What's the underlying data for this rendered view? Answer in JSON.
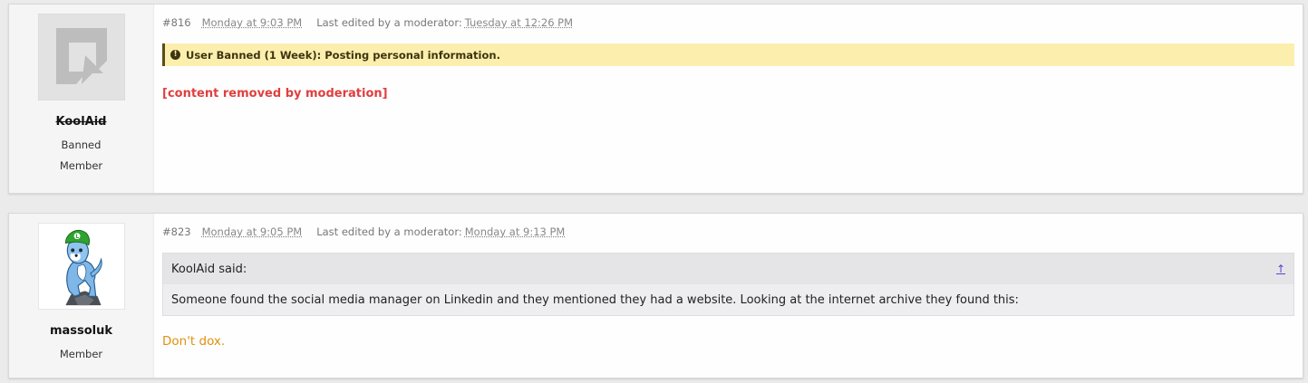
{
  "posts": [
    {
      "user": {
        "name": "KoolAid",
        "titles": [
          "Banned",
          "Member"
        ],
        "avatar": "default-logo-avatar",
        "banned": true
      },
      "number": "#816",
      "posted": "Monday at 9:03 PM",
      "edited_label": "Last edited by a moderator:",
      "edited": "Tuesday at 12:26 PM",
      "ban_notice": "User Banned (1 Week): Posting personal information.",
      "body": "[content removed by moderation]"
    },
    {
      "user": {
        "name": "massoluk",
        "titles": [
          "Member"
        ],
        "avatar": "dog-character-avatar",
        "banned": false
      },
      "number": "#823",
      "posted": "Monday at 9:05 PM",
      "edited_label": "Last edited by a moderator:",
      "edited": "Monday at 9:13 PM",
      "quote": {
        "author": "KoolAid said:",
        "jump": "↑",
        "text": "Someone found the social media manager on Linkedin and they mentioned they had a website. Looking at the internet archive they found this:"
      },
      "body": "Don't dox."
    }
  ],
  "colors": {
    "removed_text": "#e03f3f",
    "ban_notice_bg": "#fcefad",
    "reply_text": "#e0900e"
  }
}
